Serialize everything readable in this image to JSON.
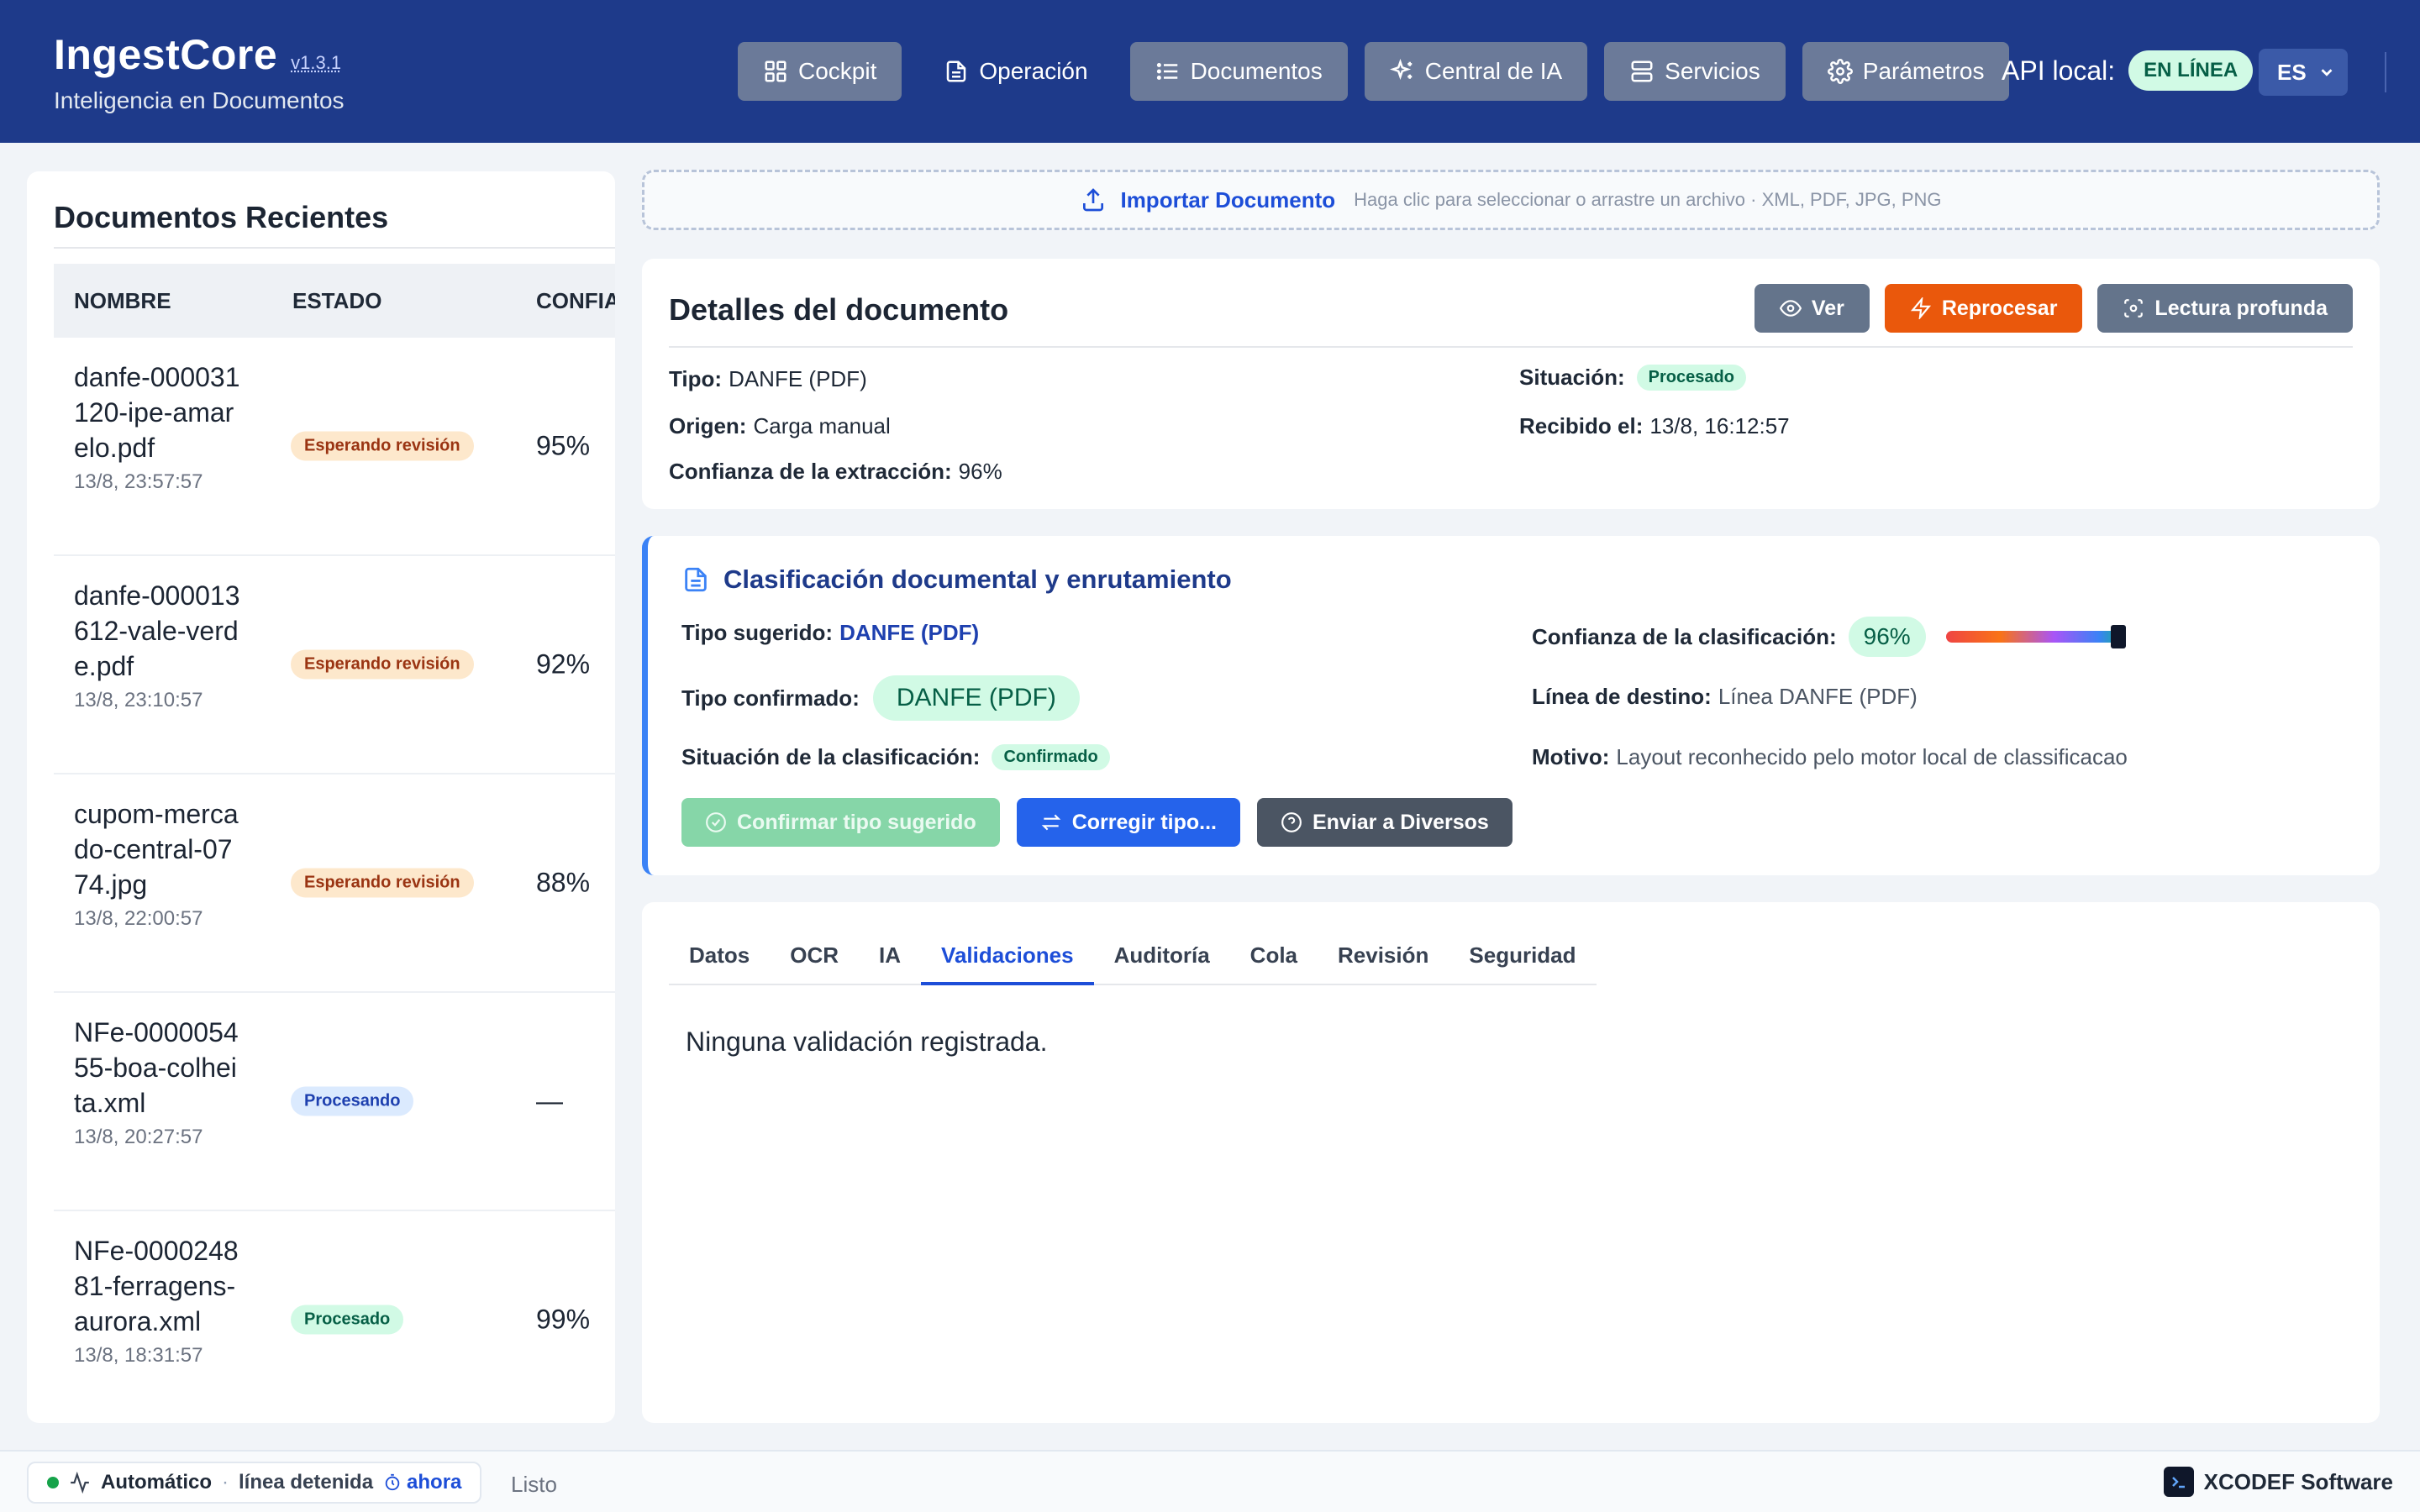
{
  "header": {
    "brand": "IngestCore",
    "version": "v1.3.1",
    "subtitle": "Inteligencia en Documentos",
    "nav": [
      {
        "label": "Cockpit",
        "icon": "grid-icon"
      },
      {
        "label": "Operación",
        "icon": "file-icon"
      },
      {
        "label": "Documentos",
        "icon": "list-icon"
      },
      {
        "label": "Central de IA",
        "icon": "sparkles-icon"
      },
      {
        "label": "Servicios",
        "icon": "server-icon"
      },
      {
        "label": "Parámetros",
        "icon": "gear-icon"
      }
    ],
    "api_label": "API local:",
    "api_status": "EN LÍNEA",
    "language": "ES"
  },
  "recent": {
    "title": "Documentos Recientes",
    "columns": [
      "NOMBRE",
      "ESTADO",
      "CONFIANZA"
    ],
    "rows": [
      {
        "name": "danfe-000031120-ipe-amarelo.pdf",
        "date": "13/8, 23:57:57",
        "status": "Esperando revisión",
        "conf": "95%"
      },
      {
        "name": "danfe-000013612-vale-verde.pdf",
        "date": "13/8, 23:10:57",
        "status": "Esperando revisión",
        "conf": "92%"
      },
      {
        "name": "cupom-mercado-central-0774.jpg",
        "date": "13/8, 22:00:57",
        "status": "Esperando revisión",
        "conf": "88%"
      },
      {
        "name": "NFe-000005455-boa-colheita.xml",
        "date": "13/8, 20:27:57",
        "status": "Procesando",
        "conf": "—"
      },
      {
        "name": "NFe-000024881-ferragens-aurora.xml",
        "date": "13/8, 18:31:57",
        "status": "Procesado",
        "conf": "99%"
      }
    ]
  },
  "upload": {
    "label": "Importar Documento",
    "hint": "Haga clic para seleccionar o arrastre un archivo · XML, PDF, JPG, PNG"
  },
  "details": {
    "title": "Detalles del documento",
    "actions": {
      "view": "Ver",
      "reprocess": "Reprocesar",
      "deep": "Lectura profunda"
    },
    "type_label": "Tipo:",
    "type_value": "DANFE (PDF)",
    "origin_label": "Origen:",
    "origin_value": "Carga manual",
    "extraction_label": "Confianza de la extracción:",
    "extraction_value": "96%",
    "situation_label": "Situación:",
    "situation_value": "Procesado",
    "received_label": "Recibido el:",
    "received_value": "13/8, 16:12:57"
  },
  "classification": {
    "title": "Clasificación documental y enrutamiento",
    "suggested_label": "Tipo sugerido:",
    "suggested_value": "DANFE (PDF)",
    "confirmed_label": "Tipo confirmado:",
    "confirmed_value": "DANFE (PDF)",
    "status_label": "Situación de la clasificación:",
    "status_value": "Confirmado",
    "confidence_label": "Confianza de la clasificación:",
    "confidence_value": "96%",
    "confidence_level": 0.96,
    "line_label": "Línea de destino:",
    "line_value": "Línea DANFE (PDF)",
    "reason_label": "Motivo:",
    "reason_value": "Layout reconhecido pelo motor local de classificacao",
    "actions": {
      "confirm": "Confirmar tipo sugerido",
      "correct": "Corregir tipo...",
      "send": "Enviar a Diversos"
    }
  },
  "tabs": {
    "items": [
      "Datos",
      "OCR",
      "IA",
      "Validaciones",
      "Auditoría",
      "Cola",
      "Revisión",
      "Seguridad"
    ],
    "active": "Validaciones",
    "empty_text": "Ninguna validación registrada."
  },
  "footer": {
    "mode": "Automático",
    "separator": "·",
    "line_state": "línea detenida",
    "now": "ahora",
    "status": "Listo",
    "brand": "XCODEF Software"
  },
  "colors": {
    "header_bg": "#1e3a8a",
    "accent": "#1d4ed8",
    "reprocess": "#ea580c",
    "success_bg": "#d1fae5"
  }
}
